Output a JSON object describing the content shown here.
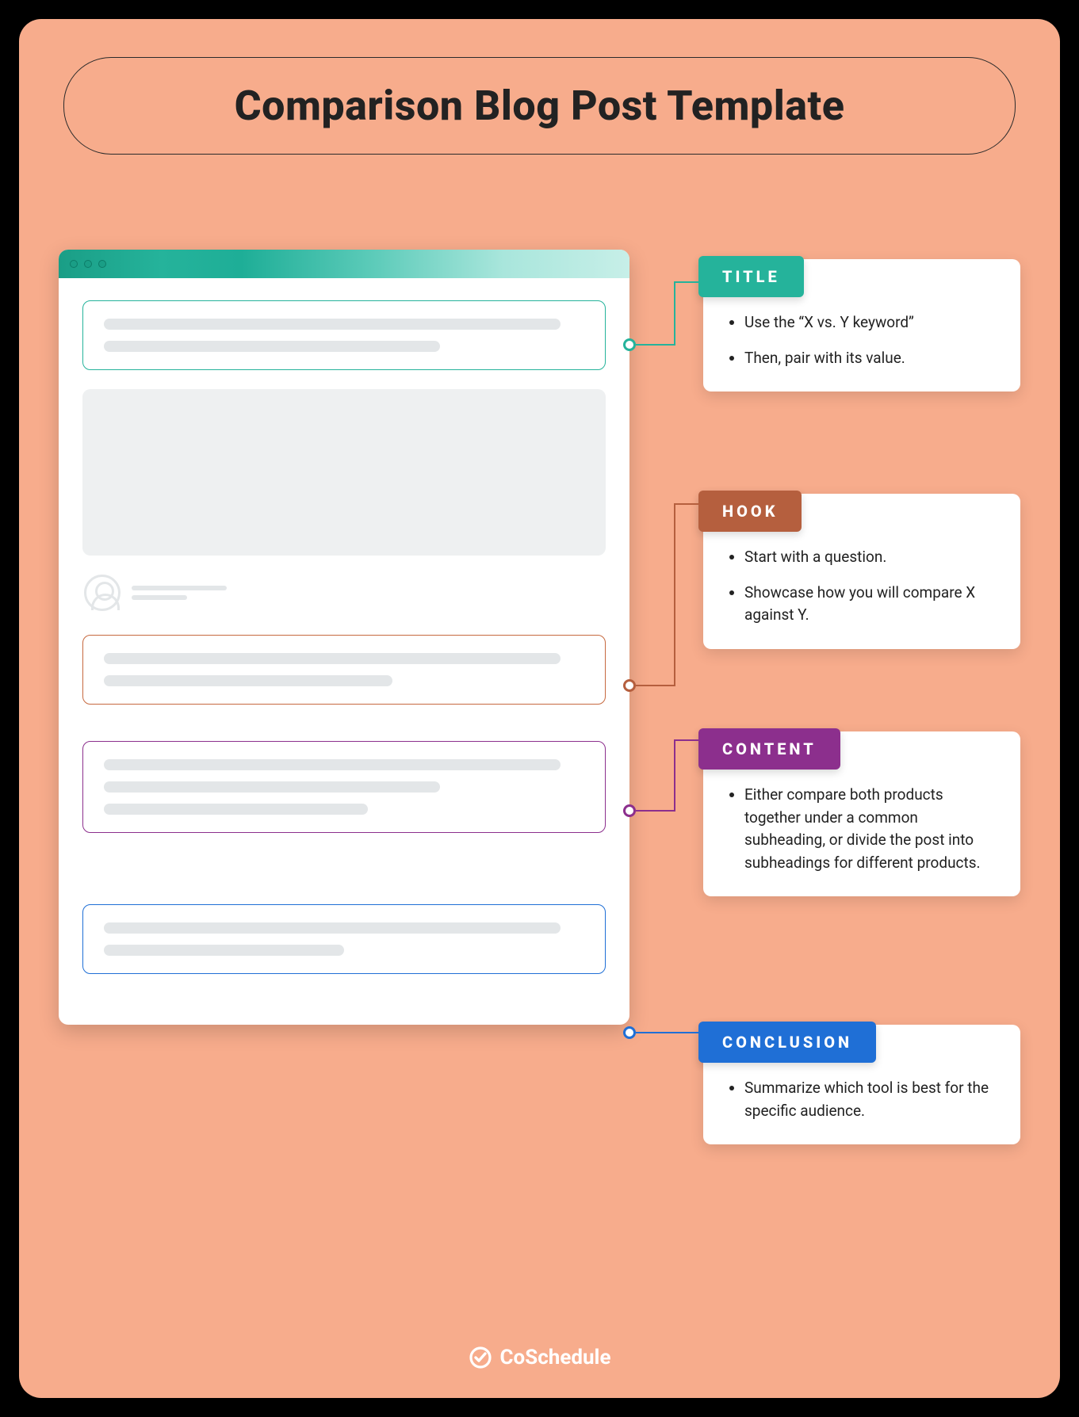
{
  "header": {
    "title": "Comparison Blog Post Template"
  },
  "callouts": {
    "title": {
      "label": "TITLE",
      "items": [
        "Use the “X vs. Y keyword”",
        "Then, pair with its value."
      ]
    },
    "hook": {
      "label": "HOOK",
      "items": [
        "Start with a question.",
        "Showcase how you will compare X against Y."
      ]
    },
    "content": {
      "label": "CONTENT",
      "items": [
        "Either compare both products together under a common subheading, or divide the post into subheadings for different products."
      ]
    },
    "conclusion": {
      "label": "CONCLUSION",
      "items": [
        "Summarize which tool is best for the specific audience."
      ]
    }
  },
  "colors": {
    "title": "#25b39b",
    "hook": "#b55f3e",
    "content": "#8c2f8d",
    "conclusion": "#1f6fd6"
  },
  "footer": {
    "brand": "CoSchedule"
  }
}
